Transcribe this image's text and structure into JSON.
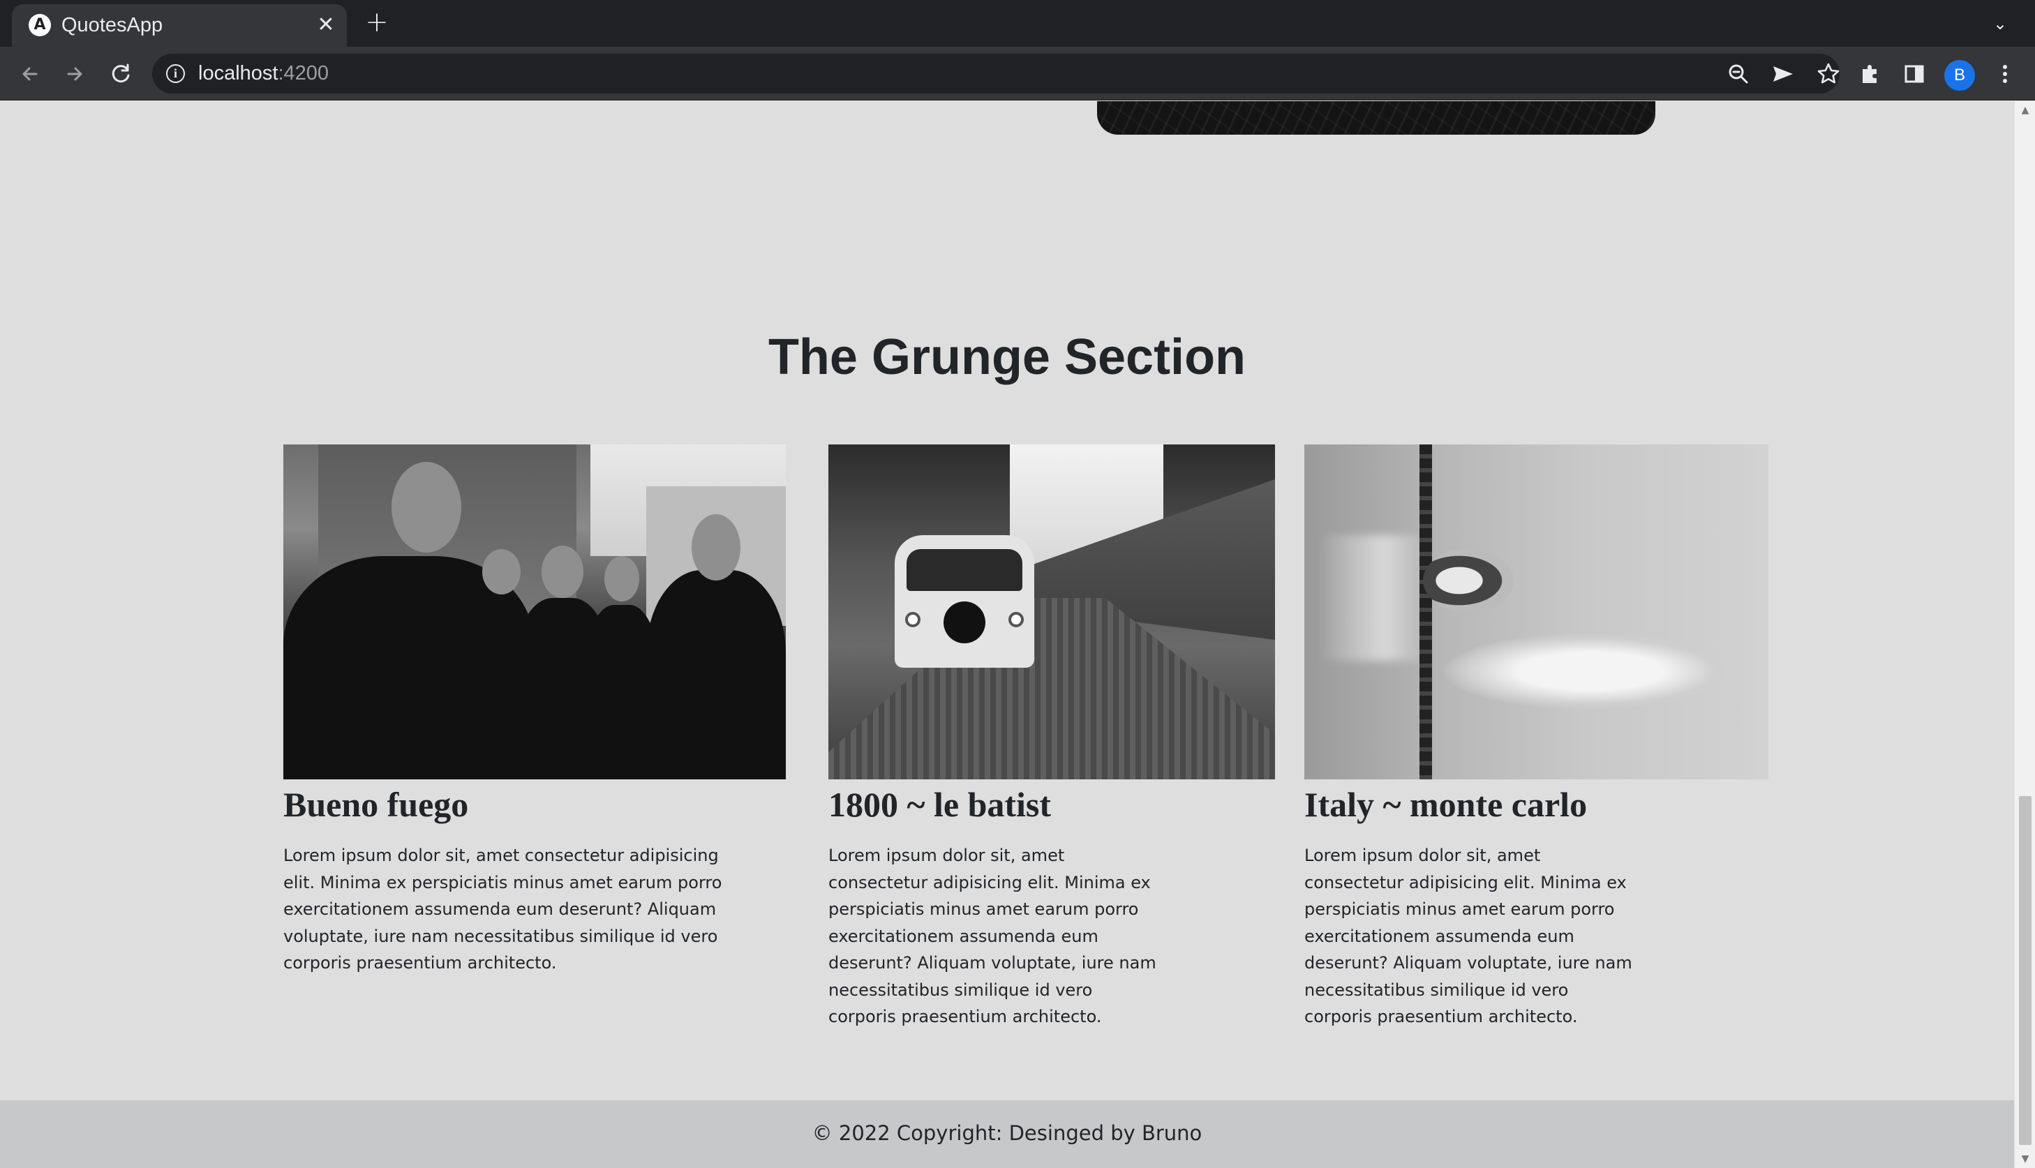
{
  "browser": {
    "tab_title": "QuotesApp",
    "tab_favicon_letter": "A",
    "close_tab_glyph": "✕",
    "new_tab_glyph": "+",
    "tab_search_glyph": "⌄",
    "url_host": "localhost",
    "url_port": ":4200",
    "avatar_letter": "B",
    "icons": [
      "back-icon",
      "forward-icon",
      "reload-icon",
      "site-info-icon",
      "zoom-icon",
      "send-icon",
      "star-icon",
      "extensions-icon",
      "side-panel-icon",
      "menu-icon"
    ]
  },
  "page": {
    "section_title": "The Grunge Section",
    "cards": [
      {
        "title": "Bueno fuego",
        "text": "Lorem ipsum dolor sit, amet consectetur adipisicing elit. Minima ex perspiciatis minus amet earum porro exercitationem assumenda eum deserunt? Aliquam voluptate, iure nam necessitatibus similique id vero corporis praesentium architecto."
      },
      {
        "title": "1800 ~ le batist",
        "text": "Lorem ipsum dolor sit, amet consectetur adipisicing elit. Minima ex perspiciatis minus amet earum porro exercitationem assumenda eum deserunt? Aliquam voluptate, iure nam necessitatibus similique id vero corporis praesentium architecto."
      },
      {
        "title": "Italy ~ monte carlo",
        "text": "Lorem ipsum dolor sit, amet consectetur adipisicing elit. Minima ex perspiciatis minus amet earum porro exercitationem assumenda eum deserunt? Aliquam voluptate, iure nam necessitatibus similique id vero corporis praesentium architecto."
      }
    ],
    "footer": "© 2022 Copyright: Desinged by Bruno"
  },
  "colors": {
    "page_background": "#dedede",
    "footer_background": "#c7c8ca",
    "text": "#212529",
    "chrome_dark": "#202124",
    "chrome_toolbar": "#35363a",
    "avatar": "#1a73e8"
  }
}
